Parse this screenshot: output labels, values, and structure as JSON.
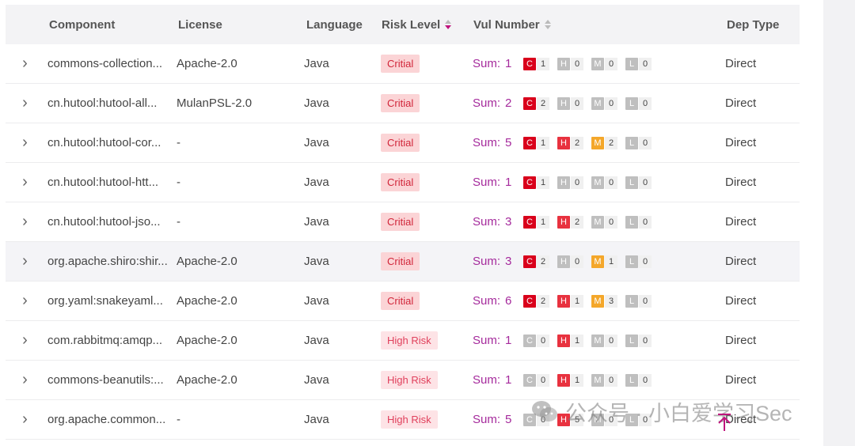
{
  "columns": {
    "component": "Component",
    "license": "License",
    "language": "Language",
    "risk_level": "Risk Level",
    "vul_number": "Vul Number",
    "dep_type": "Dep Type"
  },
  "sort": {
    "risk_level": "descending",
    "vul_number": "none"
  },
  "severity_letters": {
    "c": "C",
    "h": "H",
    "m": "M",
    "l": "L"
  },
  "severity_colors": {
    "c_active": "#d9001b",
    "h_active": "#e8323f",
    "m_active": "#f4a72a",
    "inactive": "#bfbfbf",
    "critical_tag_bg": "#fbd4d6",
    "high_tag_bg": "#fde3e6",
    "sum_text": "#a52a9c",
    "sort_active": "#c0147d"
  },
  "rows": [
    {
      "component": "commons-collection...",
      "license": "Apache-2.0",
      "language": "Java",
      "risk": "Critial",
      "risk_type": "critical",
      "sum_label": "Sum:",
      "sum": "1",
      "c": "1",
      "h": "0",
      "m": "0",
      "l": "0",
      "dep_type": "Direct"
    },
    {
      "component": "cn.hutool:hutool-all...",
      "license": "MulanPSL-2.0",
      "language": "Java",
      "risk": "Critial",
      "risk_type": "critical",
      "sum_label": "Sum:",
      "sum": "2",
      "c": "2",
      "h": "0",
      "m": "0",
      "l": "0",
      "dep_type": "Direct"
    },
    {
      "component": "cn.hutool:hutool-cor...",
      "license": "-",
      "language": "Java",
      "risk": "Critial",
      "risk_type": "critical",
      "sum_label": "Sum:",
      "sum": "5",
      "c": "1",
      "h": "2",
      "m": "2",
      "l": "0",
      "dep_type": "Direct"
    },
    {
      "component": "cn.hutool:hutool-htt...",
      "license": "-",
      "language": "Java",
      "risk": "Critial",
      "risk_type": "critical",
      "sum_label": "Sum:",
      "sum": "1",
      "c": "1",
      "h": "0",
      "m": "0",
      "l": "0",
      "dep_type": "Direct"
    },
    {
      "component": "cn.hutool:hutool-jso...",
      "license": "-",
      "language": "Java",
      "risk": "Critial",
      "risk_type": "critical",
      "sum_label": "Sum:",
      "sum": "3",
      "c": "1",
      "h": "2",
      "m": "0",
      "l": "0",
      "dep_type": "Direct"
    },
    {
      "component": "org.apache.shiro:shir...",
      "license": "Apache-2.0",
      "language": "Java",
      "risk": "Critial",
      "risk_type": "critical",
      "sum_label": "Sum:",
      "sum": "3",
      "c": "2",
      "h": "0",
      "m": "1",
      "l": "0",
      "dep_type": "Direct"
    },
    {
      "component": "org.yaml:snakeyaml...",
      "license": "Apache-2.0",
      "language": "Java",
      "risk": "Critial",
      "risk_type": "critical",
      "sum_label": "Sum:",
      "sum": "6",
      "c": "2",
      "h": "1",
      "m": "3",
      "l": "0",
      "dep_type": "Direct"
    },
    {
      "component": "com.rabbitmq:amqp...",
      "license": "Apache-2.0",
      "language": "Java",
      "risk": "High Risk",
      "risk_type": "high",
      "sum_label": "Sum:",
      "sum": "1",
      "c": "0",
      "h": "1",
      "m": "0",
      "l": "0",
      "dep_type": "Direct"
    },
    {
      "component": "commons-beanutils:...",
      "license": "Apache-2.0",
      "language": "Java",
      "risk": "High Risk",
      "risk_type": "high",
      "sum_label": "Sum:",
      "sum": "1",
      "c": "0",
      "h": "1",
      "m": "0",
      "l": "0",
      "dep_type": "Direct"
    },
    {
      "component": "org.apache.common...",
      "license": "-",
      "language": "Java",
      "risk": "High Risk",
      "risk_type": "high",
      "sum_label": "Sum:",
      "sum": "5",
      "c": "0",
      "h": "5",
      "m": "0",
      "l": "0",
      "dep_type": "Direct"
    }
  ],
  "hover_row_index": 5,
  "watermark": {
    "text": "公众号 · 小白爱学习Sec",
    "icon": "wechat-icon"
  },
  "scroll_top_icon": "arrow-up-icon"
}
